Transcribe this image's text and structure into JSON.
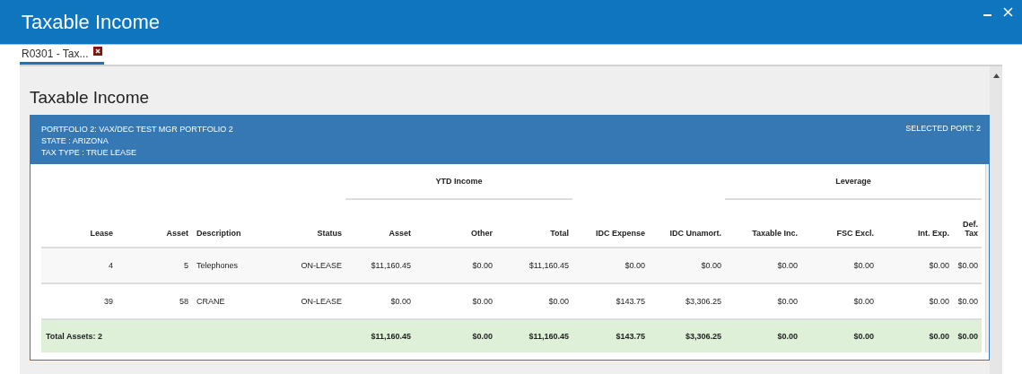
{
  "window": {
    "title": "Taxable Income"
  },
  "tabs": [
    {
      "label": "R0301 - Tax...",
      "selected": true
    }
  ],
  "page": {
    "heading": "Taxable Income"
  },
  "portfolio": {
    "lines": [
      "PORTFOLIO  2:  VAX/DEC TEST MGR PORTFOLIO 2",
      "STATE : ARIZONA",
      "TAX TYPE : TRUE LEASE"
    ],
    "selected_port": "SELECTED PORT: 2"
  },
  "table": {
    "column_groups": [
      {
        "kind": "blank",
        "columns": [
          {
            "label": "Lease",
            "kind": "number"
          },
          {
            "label": "Asset",
            "kind": "number"
          },
          {
            "label": "Description",
            "kind": "text"
          },
          {
            "label": "Status",
            "kind": "number"
          }
        ]
      },
      {
        "kind": "group",
        "label": "YTD Income",
        "columns": [
          {
            "label": "Asset",
            "kind": "number"
          },
          {
            "label": "Other",
            "kind": "number"
          },
          {
            "label": "Total",
            "kind": "number"
          }
        ]
      },
      {
        "kind": "blank",
        "columns": [
          {
            "label": "IDC Expense",
            "kind": "number"
          },
          {
            "label": "IDC Unamort.",
            "kind": "number"
          }
        ]
      },
      {
        "kind": "group",
        "label": "Leverage",
        "columns": [
          {
            "label": "Taxable Inc.",
            "kind": "number"
          },
          {
            "label": "FSC Excl.",
            "kind": "number"
          },
          {
            "label": "Int. Exp.",
            "kind": "number"
          },
          {
            "label": "Def. Tax",
            "kind": "number"
          }
        ]
      }
    ],
    "rows": [
      {
        "cells": [
          "4",
          "5",
          "Telephones",
          "ON-LEASE",
          "$11,160.45",
          "$0.00",
          "$11,160.45",
          "$0.00",
          "$0.00",
          "$0.00",
          "$0.00",
          "$0.00",
          "$0.00"
        ]
      },
      {
        "cells": [
          "39",
          "58",
          "CRANE",
          "ON-LEASE",
          "$0.00",
          "$0.00",
          "$0.00",
          "$143.75",
          "$3,306.25",
          "$0.00",
          "$0.00",
          "$0.00",
          "$0.00"
        ]
      }
    ],
    "total": {
      "label": "Total Assets: 2",
      "cells": [
        "$11,160.45",
        "$0.00",
        "$11,160.45",
        "$143.75",
        "$3,306.25",
        "$0.00",
        "$0.00",
        "$0.00",
        "$0.00"
      ]
    }
  }
}
